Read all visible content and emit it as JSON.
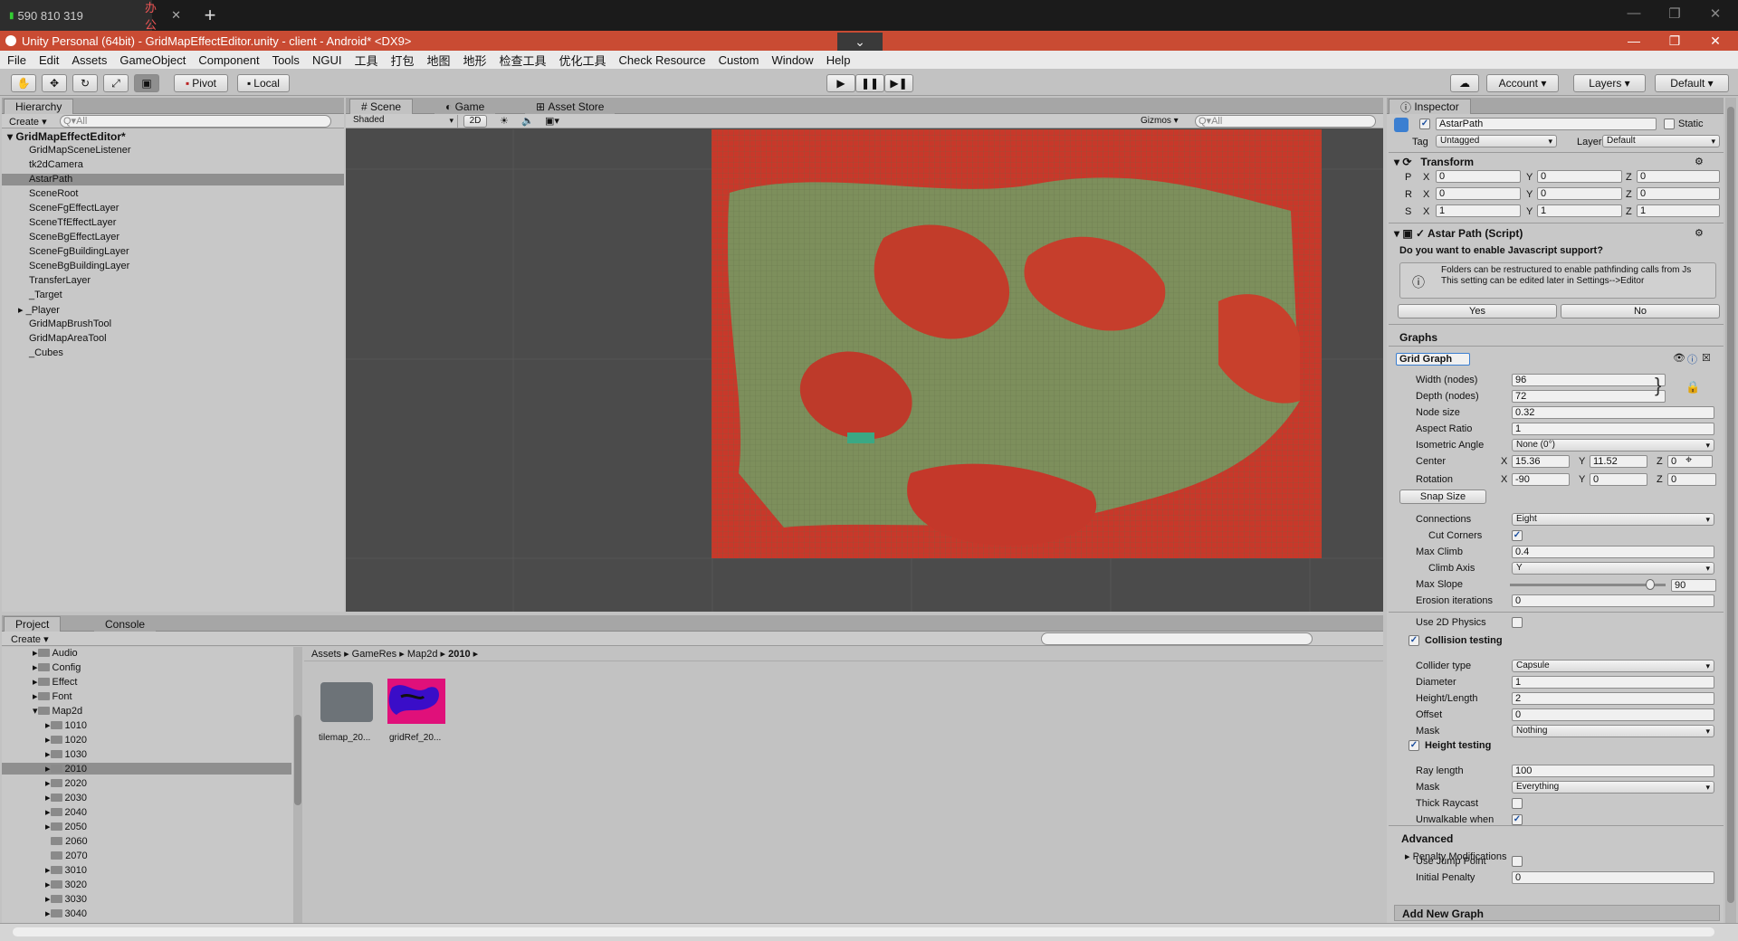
{
  "remote_tabs": [
    {
      "label": "590 810 319"
    },
    {
      "label": "办公"
    }
  ],
  "window_title": "Unity Personal (64bit) - GridMapEffectEditor.unity - client - Android* <DX9>",
  "menu": [
    "File",
    "Edit",
    "Assets",
    "GameObject",
    "Component",
    "Tools",
    "NGUI",
    "工具",
    "打包",
    "地图",
    "地形",
    "检查工具",
    "优化工具",
    "Check Resource",
    "Custom",
    "Window",
    "Help"
  ],
  "toolbar": {
    "pivot": "Pivot",
    "local": "Local",
    "account": "Account",
    "layers": "Layers",
    "layout": "Default"
  },
  "hierarchy": {
    "tab": "Hierarchy",
    "create": "Create",
    "search_placeholder": "Q▾All",
    "scene": "GridMapEffectEditor*",
    "items": [
      "GridMapSceneListener",
      "tk2dCamera",
      "AstarPath",
      "SceneRoot",
      "SceneFgEffectLayer",
      "SceneTfEffectLayer",
      "SceneBgEffectLayer",
      "SceneFgBuildingLayer",
      "SceneBgBuildingLayer",
      "TransferLayer",
      "_Target",
      "_Player",
      "GridMapBrushTool",
      "GridMapAreaTool",
      "_Cubes"
    ],
    "selected": "AstarPath"
  },
  "scene_view": {
    "tabs": [
      "Scene",
      "Game",
      "Asset Store"
    ],
    "shading": "Shaded",
    "mode2d": "2D",
    "gizmos": "Gizmos",
    "search_placeholder": "Q▾All"
  },
  "project": {
    "tabs": [
      "Project",
      "Console"
    ],
    "create": "Create",
    "folders": [
      {
        "name": "Audio",
        "indent": 0
      },
      {
        "name": "Config",
        "indent": 0
      },
      {
        "name": "Effect",
        "indent": 0
      },
      {
        "name": "Font",
        "indent": 0
      },
      {
        "name": "Map2d",
        "indent": 0
      },
      {
        "name": "1010",
        "indent": 1
      },
      {
        "name": "1020",
        "indent": 1
      },
      {
        "name": "1030",
        "indent": 1
      },
      {
        "name": "2010",
        "indent": 1
      },
      {
        "name": "2020",
        "indent": 1
      },
      {
        "name": "2030",
        "indent": 1
      },
      {
        "name": "2040",
        "indent": 1
      },
      {
        "name": "2050",
        "indent": 1
      },
      {
        "name": "2060",
        "indent": 1
      },
      {
        "name": "2070",
        "indent": 1
      },
      {
        "name": "3010",
        "indent": 1
      },
      {
        "name": "3020",
        "indent": 1
      },
      {
        "name": "3030",
        "indent": 1
      },
      {
        "name": "3040",
        "indent": 1
      }
    ],
    "selected": "2010",
    "breadcrumb": [
      "Assets",
      "GameRes",
      "Map2d",
      "2010"
    ],
    "assets": [
      {
        "name": "tilemap_20..."
      },
      {
        "name": "gridRef_20..."
      }
    ]
  },
  "inspector": {
    "tab": "Inspector",
    "object_name": "AstarPath",
    "static_label": "Static",
    "tag_label": "Tag",
    "tag": "Untagged",
    "layer_label": "Layer",
    "layer": "Default",
    "transform": {
      "title": "Transform",
      "position": [
        "0",
        "0",
        "0"
      ],
      "rotation": [
        "0",
        "0",
        "0"
      ],
      "scale": [
        "1",
        "1",
        "1"
      ]
    },
    "script": {
      "title": "Astar Path (Script)",
      "question": "Do you want to enable Javascript support?",
      "help": "Folders can be restructured to enable pathfinding calls from Js\nThis setting can be edited later in Settings-->Editor",
      "yes": "Yes",
      "no": "No"
    },
    "graphs_label": "Graphs",
    "graph_name": "Grid Graph",
    "width_label": "Width (nodes)",
    "width": "96",
    "depth_label": "Depth (nodes)",
    "depth": "72",
    "node_size_label": "Node size",
    "node_size": "0.32",
    "aspect_label": "Aspect Ratio",
    "aspect": "1",
    "iso_label": "Isometric Angle",
    "iso": "None (0°)",
    "center_label": "Center",
    "center": [
      "15.36",
      "11.52",
      "0"
    ],
    "rotation_label": "Rotation",
    "rotation": [
      "-90",
      "0",
      "0"
    ],
    "snap": "Snap Size",
    "connections_label": "Connections",
    "connections": "Eight",
    "cut_corners_label": "Cut Corners",
    "max_climb_label": "Max Climb",
    "max_climb": "0.4",
    "climb_axis_label": "Climb Axis",
    "climb_axis": "Y",
    "max_slope_label": "Max Slope",
    "max_slope": "90",
    "max_slope_fraction": 0.9,
    "erosion_label": "Erosion iterations",
    "erosion": "0",
    "physics2d_label": "Use 2D Physics",
    "collision_label": "Collision testing",
    "collider_label": "Collider type",
    "collider": "Capsule",
    "diameter_label": "Diameter",
    "diameter": "1",
    "height_length_label": "Height/Length",
    "height_length": "2",
    "offset_label": "Offset",
    "offset": "0",
    "mask_label": "Mask",
    "mask": "Nothing",
    "height_testing_label": "Height testing",
    "ray_label": "Ray length",
    "ray": "100",
    "mask2_label": "Mask",
    "mask2": "Everything",
    "thick_label": "Thick Raycast",
    "unwalk_label": "Unwalkable when",
    "advanced_label": "Advanced",
    "penalty_label": "Penalty Modifications",
    "jump_label": "Use Jump Point",
    "init_penalty_label": "Initial Penalty",
    "init_penalty": "0",
    "add_graph": "Add New Graph"
  },
  "colors": {
    "title_bar": "#c94b33",
    "panel": "#c2c2c2",
    "scene_bg": "#4a4a4a",
    "map_red": "#c8382a",
    "map_green": "#7a8f5a"
  }
}
